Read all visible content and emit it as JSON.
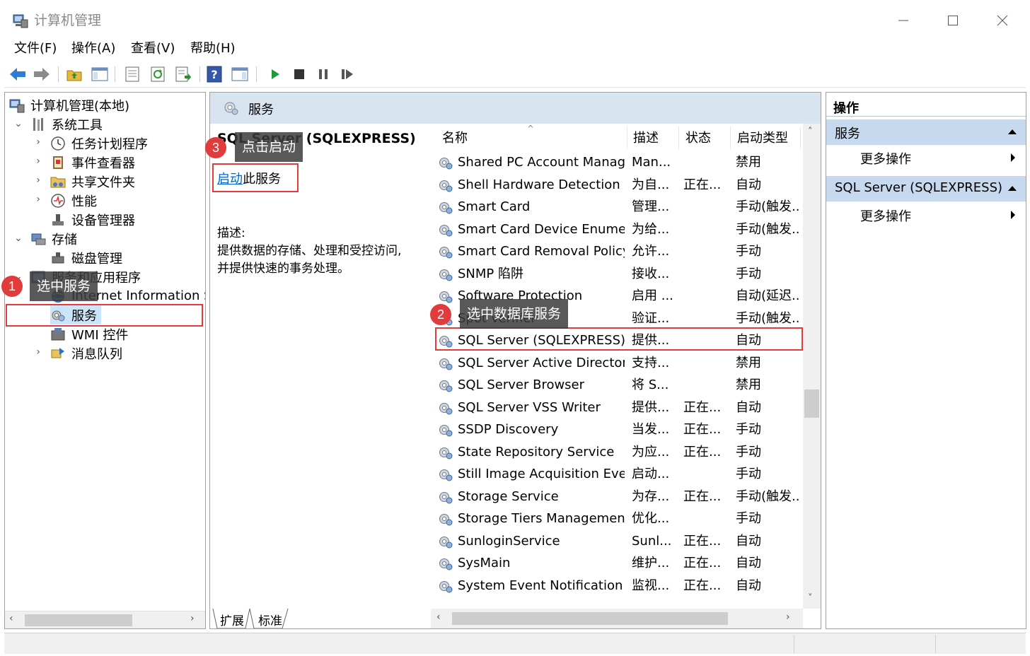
{
  "window": {
    "title": "计算机管理",
    "controls": {
      "minimize": "minimize-icon",
      "maximize": "maximize-icon",
      "close": "close-icon"
    }
  },
  "menu": [
    "文件(F)",
    "操作(A)",
    "查看(V)",
    "帮助(H)"
  ],
  "toolbar": [
    "back-arrow-icon",
    "forward-arrow-icon",
    "up-folder-icon",
    "show-hide-tree-icon",
    "properties-icon",
    "refresh-icon",
    "export-list-icon",
    "help-icon",
    "show-hide-action-pane-icon",
    "start-service-icon",
    "stop-service-icon",
    "pause-service-icon",
    "restart-service-icon"
  ],
  "tree": {
    "root": "计算机管理(本地)",
    "system_tools": "系统工具",
    "task_scheduler": "任务计划程序",
    "event_viewer": "事件查看器",
    "shared_folders": "共享文件夹",
    "performance": "性能",
    "device_manager": "设备管理器",
    "storage": "存储",
    "disk_management": "磁盘管理",
    "services_apps": "服务和应用程序",
    "iis": "Internet Information Se",
    "services": "服务",
    "wmi": "WMI 控件",
    "message_queue": "消息队列"
  },
  "center": {
    "header": "服务",
    "selected_service": "SQL Server (SQLEXPRESS)",
    "start_link": "启动",
    "start_suffix": "此服务",
    "description_label": "描述:",
    "description_line1": "提供数据的存储、处理和受控访问,",
    "description_line2": "并提供快速的事务处理。",
    "tabs": [
      "扩展",
      "标准"
    ]
  },
  "list": {
    "columns": {
      "name": "名称",
      "desc": "描述",
      "status": "状态",
      "startup": "启动类型"
    },
    "rows": [
      {
        "name": "Shared PC Account Manager",
        "desc": "Man...",
        "status": "",
        "startup": "禁用"
      },
      {
        "name": "Shell Hardware Detection",
        "desc": "为自...",
        "status": "正在...",
        "startup": "自动"
      },
      {
        "name": "Smart Card",
        "desc": "管理...",
        "status": "",
        "startup": "手动(触发..."
      },
      {
        "name": "Smart Card Device Enumer...",
        "desc": "为给...",
        "status": "",
        "startup": "手动(触发..."
      },
      {
        "name": "Smart Card Removal Policy",
        "desc": "允许...",
        "status": "",
        "startup": "手动"
      },
      {
        "name": "SNMP 陷阱",
        "desc": "接收...",
        "status": "",
        "startup": "手动"
      },
      {
        "name": "Software Protection",
        "desc": "启用 ...",
        "status": "",
        "startup": "自动(延迟..."
      },
      {
        "name": "Spot Verifier",
        "desc": "验证...",
        "status": "",
        "startup": "手动(触发..."
      },
      {
        "name": "SQL Server (SQLEXPRESS)",
        "desc": "提供...",
        "status": "",
        "startup": "自动"
      },
      {
        "name": "SQL Server Active Director...",
        "desc": "支持...",
        "status": "",
        "startup": "禁用"
      },
      {
        "name": "SQL Server Browser",
        "desc": "将 S...",
        "status": "",
        "startup": "禁用"
      },
      {
        "name": "SQL Server VSS Writer",
        "desc": "提供...",
        "status": "正在...",
        "startup": "自动"
      },
      {
        "name": "SSDP Discovery",
        "desc": "当发...",
        "status": "正在...",
        "startup": "手动"
      },
      {
        "name": "State Repository Service",
        "desc": "为应...",
        "status": "正在...",
        "startup": "手动"
      },
      {
        "name": "Still Image Acquisition Eve...",
        "desc": "启动...",
        "status": "",
        "startup": "手动"
      },
      {
        "name": "Storage Service",
        "desc": "为存...",
        "status": "正在...",
        "startup": "手动(触发..."
      },
      {
        "name": "Storage Tiers Management",
        "desc": "优化...",
        "status": "",
        "startup": "手动"
      },
      {
        "name": "SunloginService",
        "desc": "Sunl...",
        "status": "正在...",
        "startup": "自动"
      },
      {
        "name": "SysMain",
        "desc": "维护...",
        "status": "正在...",
        "startup": "自动"
      },
      {
        "name": "System Event Notification ...",
        "desc": "监视...",
        "status": "正在...",
        "startup": "自动"
      }
    ]
  },
  "actions": {
    "title": "操作",
    "section1": "服务",
    "more1": "更多操作",
    "section2": "SQL Server (SQLEXPRESS)",
    "more2": "更多操作"
  },
  "annotations": [
    {
      "number": "1",
      "text": "选中服务"
    },
    {
      "number": "2",
      "text": "选中数据库服务"
    },
    {
      "number": "3",
      "text": "点击启动"
    }
  ],
  "colors": {
    "annotation_red": "#e23b3b",
    "header_blue": "#d9e4f1",
    "action_section_blue": "#c6d9ee",
    "link_blue": "#0066cc"
  }
}
